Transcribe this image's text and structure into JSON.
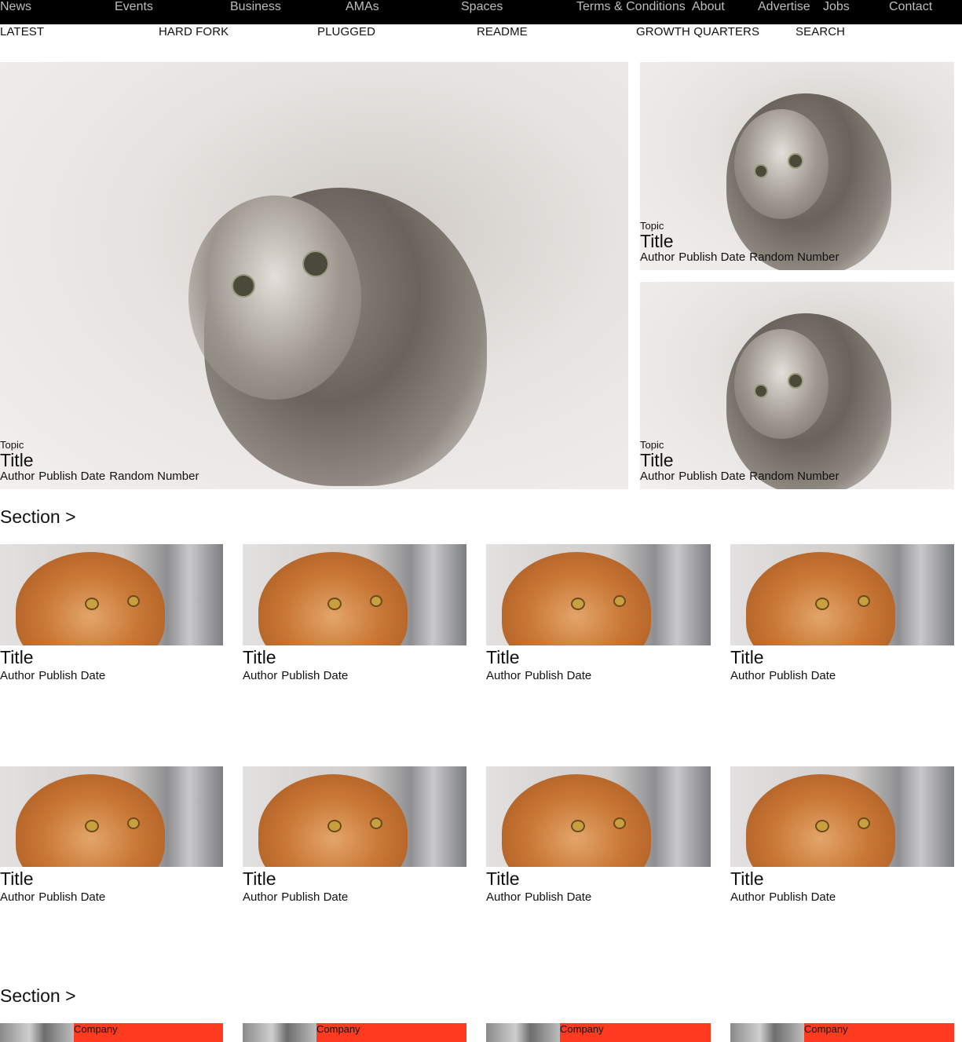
{
  "topnav": {
    "items": [
      "News",
      "Events",
      "Business",
      "AMAs",
      "Spaces",
      "Terms & Conditions",
      "About",
      "Advertise",
      "Jobs",
      "Contact"
    ]
  },
  "subnav": {
    "items": [
      "LATEST",
      "HARD FORK",
      "PLUGGED",
      "README",
      "GROWTH QUARTERS",
      "SEARCH"
    ]
  },
  "hero": {
    "main": {
      "topic": "Topic",
      "title": "Title",
      "author": "Author",
      "date": "Publish Date",
      "number": "Random Number"
    },
    "side": [
      {
        "topic": "Topic",
        "title": "Title",
        "author": "Author",
        "date": "Publish Date",
        "number": "Random Number"
      },
      {
        "topic": "Topic",
        "title": "Title",
        "author": "Author",
        "date": "Publish Date",
        "number": "Random Number"
      }
    ]
  },
  "sections": [
    {
      "heading": "Section >"
    },
    {
      "heading": "Section >"
    }
  ],
  "cards": [
    {
      "title": "Title",
      "author": "Author",
      "date": "Publish Date"
    },
    {
      "title": "Title",
      "author": "Author",
      "date": "Publish Date"
    },
    {
      "title": "Title",
      "author": "Author",
      "date": "Publish Date"
    },
    {
      "title": "Title",
      "author": "Author",
      "date": "Publish Date"
    },
    {
      "title": "Title",
      "author": "Author",
      "date": "Publish Date"
    },
    {
      "title": "Title",
      "author": "Author",
      "date": "Publish Date"
    },
    {
      "title": "Title",
      "author": "Author",
      "date": "Publish Date"
    },
    {
      "title": "Title",
      "author": "Author",
      "date": "Publish Date"
    }
  ],
  "companies": [
    {
      "label": "Company"
    },
    {
      "label": "Company"
    },
    {
      "label": "Company"
    },
    {
      "label": "Company"
    }
  ],
  "colors": {
    "topbar": "#000000",
    "topnav_text": "#bdbdbd",
    "company_accent": "#ff3b1f"
  }
}
